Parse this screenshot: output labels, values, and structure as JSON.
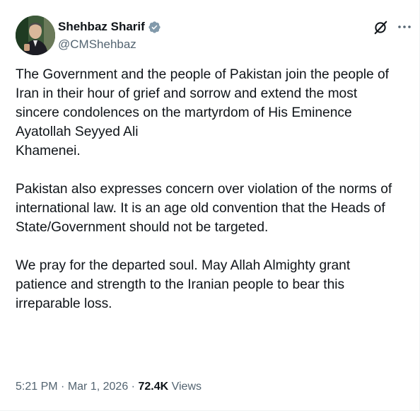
{
  "author": {
    "display_name": "Shehbaz Sharif",
    "handle": "@CMShehbaz",
    "verified": true,
    "avatar_icon": "profile-photo",
    "verified_color": "#829aab"
  },
  "tweet": {
    "text": "The Government and the people of Pakistan join the people of Iran in their hour of grief and sorrow and extend the most sincere condolences on the martyrdom of His Eminence Ayatollah Seyyed Ali\nKhamenei.\n\nPakistan also expresses concern over violation of the norms of international law. It is an age old convention that the Heads of State/Government should not be targeted.\n\nWe pray for the departed soul. May Allah Almighty grant patience and strength to the Iranian people to bear this irreparable loss."
  },
  "meta": {
    "time": "5:21 PM",
    "separator": "·",
    "date": "Mar 1, 2026",
    "views_count": "72.4K",
    "views_label": "Views"
  },
  "icons": {
    "grok": "grok-icon",
    "more": "more-icon"
  },
  "colors": {
    "text": "#0f1419",
    "secondary": "#536471"
  }
}
